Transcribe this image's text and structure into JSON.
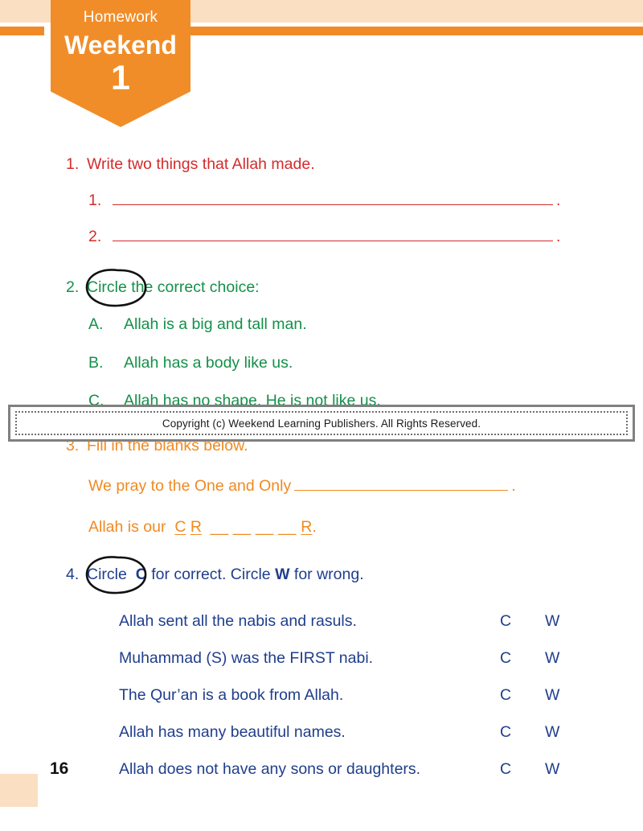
{
  "banner": {
    "kicker": "Homework",
    "title": "Weekend",
    "number": "1"
  },
  "colors": {
    "orange": "#F18D28",
    "peach": "#FBDFC2",
    "red": "#D42B2B",
    "green": "#149049",
    "blue": "#1F3E8C",
    "gray_border": "#808080"
  },
  "questions": [
    {
      "number": "1.",
      "prompt": "Write two things that Allah made.",
      "color": "red",
      "answer_lines": [
        {
          "label": "1.",
          "terminator": "."
        },
        {
          "label": "2.",
          "terminator": "."
        }
      ]
    },
    {
      "number": "2.",
      "prompt_circled": "Circle",
      "prompt_rest": "the correct choice:",
      "color": "green",
      "options": [
        {
          "letter": "A.",
          "text": "Allah is a big and tall man."
        },
        {
          "letter": "B.",
          "text": "Allah has a body like us."
        },
        {
          "letter": "C.",
          "text": "Allah has no shape. He is not like us."
        }
      ]
    },
    {
      "number": "3.",
      "prompt": "Fill in the blanks below.",
      "color": "orange",
      "blank_line_1": {
        "text": "We pray to the One and Only",
        "terminator": "."
      },
      "blank_line_2": {
        "lead": "Allah is our",
        "letters": [
          "C",
          "R"
        ],
        "blanks": [
          "__",
          "__",
          "__",
          "__"
        ],
        "final_letter": "R",
        "terminator": "."
      }
    },
    {
      "number": "4.",
      "prompt_circled": "Circle",
      "prompt_part1": "C",
      "prompt_part2": "for correct. Circle",
      "prompt_part3": "W",
      "prompt_part4": "for wrong.",
      "color": "blue",
      "columns": {
        "correct": "C",
        "wrong": "W"
      },
      "statements": [
        "Allah sent all the nabis and rasuls.",
        "Muhammad (S) was the FIRST nabi.",
        "The Qur’an is a book from Allah.",
        "Allah has many beautiful names.",
        "Allah does not have any sons or daughters."
      ]
    }
  ],
  "copyright": {
    "text": "Copyright (c) Weekend Learning Publishers. All Rights Reserved."
  },
  "footer": {
    "page_number": "16"
  }
}
